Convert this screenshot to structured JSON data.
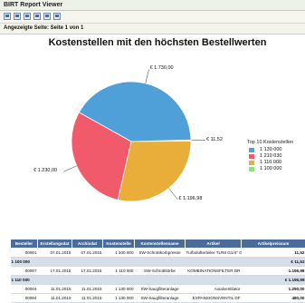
{
  "app": {
    "title": "BIRT Report Viewer"
  },
  "toolbar": {
    "icons": [
      "toc-icon",
      "run-icon",
      "export-data-icon",
      "export-report-icon",
      "print-icon",
      "print-server-icon"
    ]
  },
  "pagebar": {
    "text": "Angezeigte Seite: Seite  1  von  1"
  },
  "chart_data": {
    "type": "pie",
    "title": "Kostenstellen mit den höchsten Bestellwerten",
    "legend_title": "Top 10 Kostenstellen",
    "legend_position": "right",
    "slices": [
      {
        "label": "1 130 000",
        "value": 1730.0,
        "display": "€ 1.730,00",
        "color": "#4f9fd8"
      },
      {
        "label": "1 210 030",
        "value": 1230.0,
        "display": "€ 1.230,00",
        "color": "#f05a6a"
      },
      {
        "label": "1 110 000",
        "value": 1196.98,
        "display": "€ 1.196,98",
        "color": "#e9ad3a"
      },
      {
        "label": "1 100 000",
        "value": 11.52,
        "display": "€ 11,52",
        "color": "#8fe08a"
      }
    ]
  },
  "table": {
    "headers": [
      "Besteller",
      "Erstellungsdat",
      "Archivdat",
      "Kostenstelle",
      "Kostenstellenname",
      "Artikel",
      "Artikelpreissum"
    ],
    "rows": [
      {
        "kind": "row",
        "cells": [
          "00001",
          "07.01.2015",
          "07.01.2015",
          "1 100 000",
          "SW-Schrottkorbpresse",
          "Turbolüfterteiler TLR8 G1/4\" G1/8\"",
          "11,52"
        ]
      },
      {
        "kind": "group",
        "label": "1 100 000",
        "total": "€ 11,52"
      },
      {
        "kind": "row",
        "cells": [
          "00007",
          "17.01.2015",
          "17.01.2015",
          "1 110 000",
          "SW-Schrottkörbe",
          "KOMBINATIONSFILTER DR",
          "1.196,98"
        ]
      },
      {
        "kind": "group",
        "label": "1 110 000",
        "total": "€ 1.196,98"
      },
      {
        "kind": "row",
        "cells": [
          "00004",
          "11.01.2015",
          "11.01.2015",
          "1 130 000",
          "SW-Saugfilteranlage",
          "Axialventilator",
          "1.250,00"
        ]
      },
      {
        "kind": "row",
        "cells": [
          "00004",
          "11.01.2015",
          "11.01.2015",
          "1 130 000",
          "SW-Saugfilteranlage",
          "EXPANSIONSVENTIL DF",
          "480,00"
        ]
      }
    ]
  }
}
